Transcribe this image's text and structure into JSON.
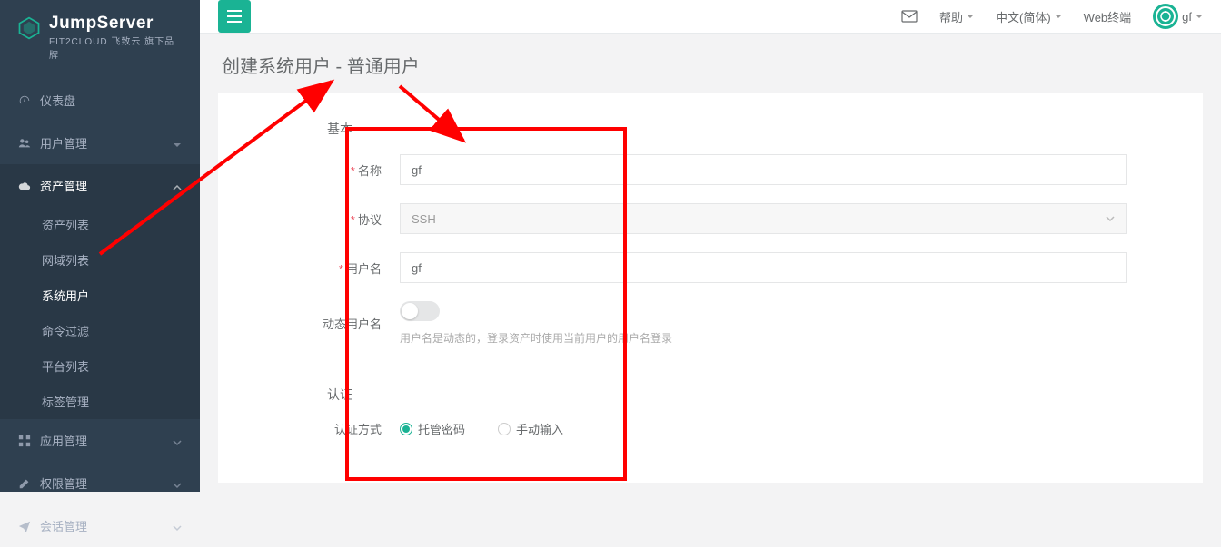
{
  "brand": {
    "title": "JumpServer",
    "subtitle": "FIT2CLOUD 飞致云 旗下品牌"
  },
  "sidebar": {
    "items": [
      {
        "label": "仪表盘",
        "icon": "dashboard"
      },
      {
        "label": "用户管理",
        "icon": "users",
        "hasArrow": true
      },
      {
        "label": "资产管理",
        "icon": "cloud",
        "hasArrow": true,
        "expanded": true,
        "children": [
          {
            "label": "资产列表"
          },
          {
            "label": "网域列表"
          },
          {
            "label": "系统用户",
            "active": true
          },
          {
            "label": "命令过滤"
          },
          {
            "label": "平台列表"
          },
          {
            "label": "标签管理"
          }
        ]
      },
      {
        "label": "应用管理",
        "icon": "grid",
        "hasArrow": true
      },
      {
        "label": "权限管理",
        "icon": "edit",
        "hasArrow": true
      },
      {
        "label": "会话管理",
        "icon": "send",
        "hasArrow": true
      }
    ]
  },
  "topbar": {
    "help": "帮助",
    "lang": "中文(简体)",
    "webterm": "Web终端",
    "user": "gf"
  },
  "page": {
    "title": "创建系统用户 - 普通用户"
  },
  "form": {
    "section1": "基本",
    "section2": "认证",
    "name_label": "名称",
    "name_value": "gf",
    "protocol_label": "协议",
    "protocol_value": "SSH",
    "username_label": "用户名",
    "username_value": "gf",
    "dynamic_label": "动态用户名",
    "dynamic_help": "用户名是动态的，登录资产时使用当前用户的用户名登录",
    "auth_method_label": "认证方式",
    "auth_method_opt1": "托管密码",
    "auth_method_opt2": "手动输入"
  }
}
